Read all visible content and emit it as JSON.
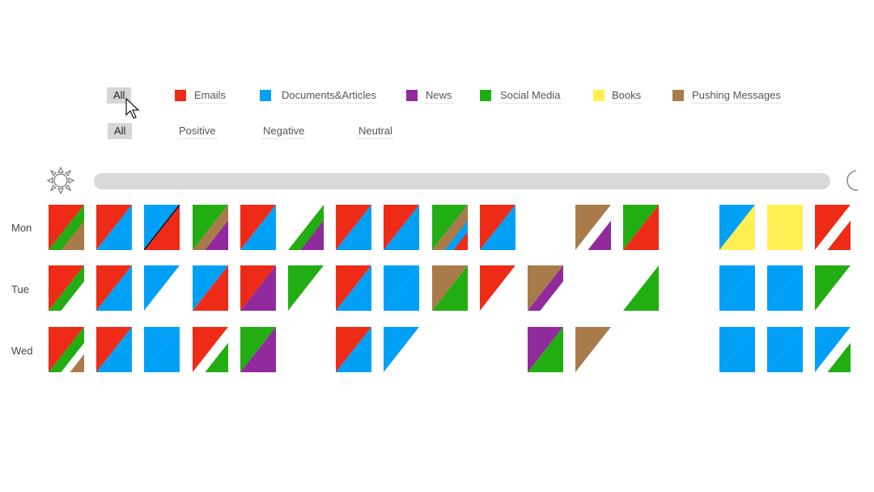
{
  "filters": {
    "all_label": "All",
    "categories": [
      {
        "label": "Emails",
        "color": "#ee2b16"
      },
      {
        "label": "Documents&Articles",
        "color": "#00a0f7"
      },
      {
        "label": "News",
        "color": "#912a9c"
      },
      {
        "label": "Social Media",
        "color": "#22ad12"
      },
      {
        "label": "Books",
        "color": "#ffef52"
      },
      {
        "label": "Pushing Messages",
        "color": "#a97b4b"
      }
    ],
    "sentiment_all_label": "All",
    "sentiments": [
      "Positive",
      "Negative",
      "Neutral"
    ]
  },
  "timeline": {
    "start_icon": "sun-icon",
    "end_icon": "moon-icon"
  },
  "days": [
    {
      "label": "Mon",
      "cells": [
        {
          "a": "#ee2b16",
          "b": "#22ad12",
          "c": "#a97b4b"
        },
        {
          "a": "#ee2b16",
          "b": "#00a0f7"
        },
        {
          "a": "#00a0f7",
          "b": "#ee2b16",
          "line": true
        },
        {
          "a": "#22ad12",
          "b": "#a97b4b",
          "c": "#912a9c"
        },
        {
          "a": "#ee2b16",
          "b": "#00a0f7"
        },
        {
          "a": "#ffffff",
          "b": "#22ad12",
          "c": "#912a9c"
        },
        {
          "a": "#ee2b16",
          "b": "#00a0f7"
        },
        {
          "a": "#ee2b16",
          "b": "#00a0f7"
        },
        {
          "a": "#22ad12",
          "b": "#a97b4b",
          "c": "#00a0f7",
          "d": "#ee2b16"
        },
        {
          "a": "#ee2b16",
          "b": "#00a0f7"
        },
        {
          "a": "#ffffff",
          "b": "#ffffff"
        },
        {
          "a": "#a97b4b",
          "b": "#ffffff",
          "c": "#912a9c"
        },
        {
          "a": "#22ad12",
          "b": "#ee2b16"
        },
        {
          "a": "#ffffff",
          "b": "#ffffff"
        },
        {
          "a": "#00a0f7",
          "b": "#ffef52"
        },
        {
          "a": "#ffef52",
          "b": "#ffef52"
        },
        {
          "a": "#ee2b16",
          "b": "#ffffff",
          "c": "#ee2b16"
        }
      ]
    },
    {
      "label": "Tue",
      "cells": [
        {
          "a": "#ee2b16",
          "b": "#22ad12",
          "c": "#ffffff"
        },
        {
          "a": "#ee2b16",
          "b": "#00a0f7"
        },
        {
          "a": "#00a0f7",
          "b": "#ffffff"
        },
        {
          "a": "#00a0f7",
          "b": "#ee2b16"
        },
        {
          "a": "#ee2b16",
          "b": "#912a9c"
        },
        {
          "a": "#22ad12",
          "b": "#ffffff"
        },
        {
          "a": "#ee2b16",
          "b": "#00a0f7"
        },
        {
          "a": "#00a0f7",
          "b": "#00a0f7"
        },
        {
          "a": "#a97b4b",
          "b": "#22ad12"
        },
        {
          "a": "#ee2b16",
          "b": "#ffffff"
        },
        {
          "a": "#a97b4b",
          "b": "#912a9c",
          "c": "#ffffff"
        },
        {
          "a": "#ffffff",
          "b": "#ffffff"
        },
        {
          "a": "#ffffff",
          "b": "#22ad12"
        },
        {
          "a": "#ffffff",
          "b": "#ffffff"
        },
        {
          "a": "#00a0f7",
          "b": "#00a0f7"
        },
        {
          "a": "#00a0f7",
          "b": "#00a0f7"
        },
        {
          "a": "#22ad12",
          "b": "#ffffff"
        }
      ]
    },
    {
      "label": "Wed",
      "cells": [
        {
          "a": "#ee2b16",
          "b": "#22ad12",
          "c": "#ffffff",
          "d": "#a97b4b"
        },
        {
          "a": "#ee2b16",
          "b": "#00a0f7"
        },
        {
          "a": "#00a0f7",
          "b": "#00a0f7"
        },
        {
          "a": "#ee2b16",
          "b": "#ffffff",
          "c": "#22ad12"
        },
        {
          "a": "#22ad12",
          "b": "#912a9c"
        },
        {
          "a": "#ffffff",
          "b": "#ffffff"
        },
        {
          "a": "#ee2b16",
          "b": "#00a0f7"
        },
        {
          "a": "#00a0f7",
          "b": "#ffffff"
        },
        {
          "a": "#ffffff",
          "b": "#ffffff"
        },
        {
          "a": "#ffffff",
          "b": "#ffffff"
        },
        {
          "a": "#912a9c",
          "b": "#22ad12"
        },
        {
          "a": "#a97b4b",
          "b": "#ffffff"
        },
        {
          "a": "#ffffff",
          "b": "#ffffff"
        },
        {
          "a": "#ffffff",
          "b": "#ffffff"
        },
        {
          "a": "#00a0f7",
          "b": "#00a0f7"
        },
        {
          "a": "#00a0f7",
          "b": "#00a0f7"
        },
        {
          "a": "#00a0f7",
          "b": "#ffffff",
          "c": "#22ad12"
        }
      ]
    }
  ]
}
